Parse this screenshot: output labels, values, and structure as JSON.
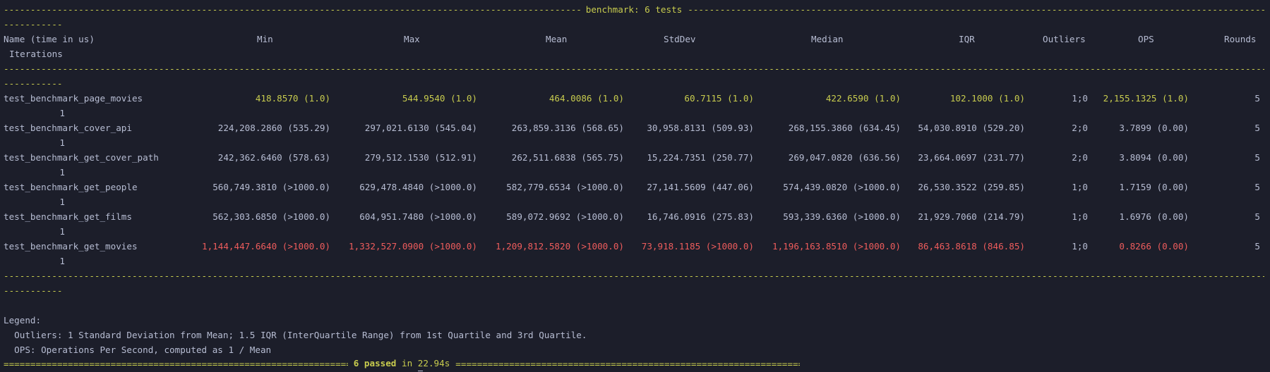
{
  "header": {
    "title": "benchmark: 6 tests",
    "wrap_dashes": "-----------"
  },
  "columns": {
    "name": "Name (time in us)",
    "min": "Min",
    "max": "Max",
    "mean": "Mean",
    "stddev": "StdDev",
    "median": "Median",
    "iqr": "IQR",
    "outliers": "Outliers",
    "ops": "OPS",
    "rounds": "Rounds",
    "iterations": "Iterations"
  },
  "rows": [
    {
      "name": "test_benchmark_page_movies",
      "min": "418.8570 (1.0)",
      "max": "544.9540 (1.0)",
      "mean": "464.0086 (1.0)",
      "stddev": "60.7115 (1.0)",
      "median": "422.6590 (1.0)",
      "iqr": "102.1000 (1.0)",
      "outliers": "1;0",
      "ops": "2,155.1325 (1.0)",
      "rounds": "5",
      "iterations": "1"
    },
    {
      "name": "test_benchmark_cover_api",
      "min": "224,208.2860 (535.29)",
      "max": "297,021.6130 (545.04)",
      "mean": "263,859.3136 (568.65)",
      "stddev": "30,958.8131 (509.93)",
      "median": "268,155.3860 (634.45)",
      "iqr": "54,030.8910 (529.20)",
      "outliers": "2;0",
      "ops": "3.7899 (0.00)",
      "rounds": "5",
      "iterations": "1"
    },
    {
      "name": "test_benchmark_get_cover_path",
      "min": "242,362.6460 (578.63)",
      "max": "279,512.1530 (512.91)",
      "mean": "262,511.6838 (565.75)",
      "stddev": "15,224.7351 (250.77)",
      "median": "269,047.0820 (636.56)",
      "iqr": "23,664.0697 (231.77)",
      "outliers": "2;0",
      "ops": "3.8094 (0.00)",
      "rounds": "5",
      "iterations": "1"
    },
    {
      "name": "test_benchmark_get_people",
      "min": "560,749.3810 (>1000.0)",
      "max": "629,478.4840 (>1000.0)",
      "mean": "582,779.6534 (>1000.0)",
      "stddev": "27,141.5609 (447.06)",
      "median": "574,439.0820 (>1000.0)",
      "iqr": "26,530.3522 (259.85)",
      "outliers": "1;0",
      "ops": "1.7159 (0.00)",
      "rounds": "5",
      "iterations": "1"
    },
    {
      "name": "test_benchmark_get_films",
      "min": "562,303.6850 (>1000.0)",
      "max": "604,951.7480 (>1000.0)",
      "mean": "589,072.9692 (>1000.0)",
      "stddev": "16,746.0916 (275.83)",
      "median": "593,339.6360 (>1000.0)",
      "iqr": "21,929.7060 (214.79)",
      "outliers": "1;0",
      "ops": "1.6976 (0.00)",
      "rounds": "5",
      "iterations": "1"
    },
    {
      "name": "test_benchmark_get_movies",
      "min": "1,144,447.6640 (>1000.0)",
      "max": "1,332,527.0900 (>1000.0)",
      "mean": "1,209,812.5820 (>1000.0)",
      "stddev": "73,918.1185 (>1000.0)",
      "median": "1,196,163.8510 (>1000.0)",
      "iqr": "86,463.8618 (846.85)",
      "outliers": "1;0",
      "ops": "0.8266 (0.00)",
      "rounds": "5",
      "iterations": "1"
    }
  ],
  "legend": {
    "title": "Legend:",
    "outliers": "  Outliers: 1 Standard Deviation from Mean; 1.5 IQR (InterQuartile Range) from 1st Quartile and 3rd Quartile.",
    "ops": "  OPS: Operations Per Second, computed as 1 / Mean"
  },
  "summary": {
    "passed": "6 passed",
    "in_word": "in",
    "time_prefix": "2",
    "time_rest": "2.94s"
  },
  "colors": {
    "background": "#1c1e2a",
    "text": "#b7bdd3",
    "best": "#c8cc4e",
    "worst": "#ee5c5c"
  }
}
